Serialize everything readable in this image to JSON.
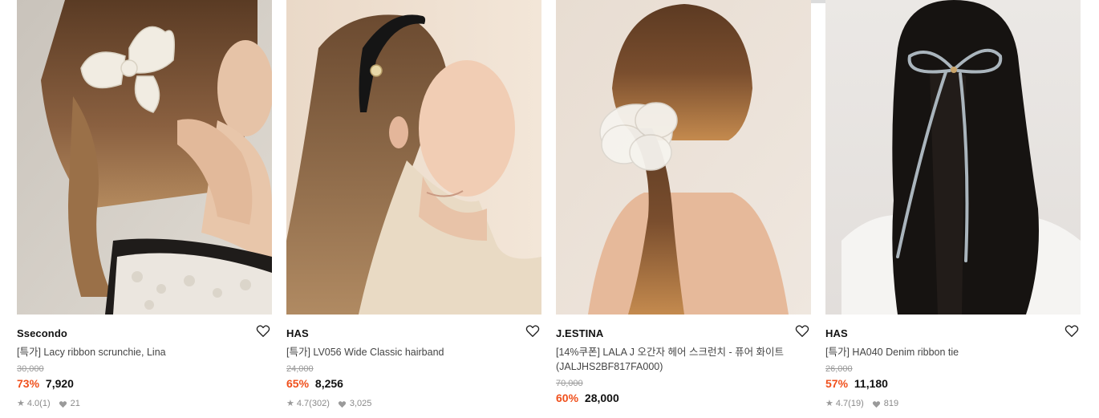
{
  "products": [
    {
      "brand": "Ssecondo",
      "name": "[특가] Lacy ribbon scrunchie, Lina",
      "original_price": "30,000",
      "discount": "73%",
      "price": "7,920",
      "rating": "4.0",
      "reviews": "(1)",
      "likes": "21",
      "image": "woman-with-lace-bow-scrunchie"
    },
    {
      "brand": "HAS",
      "name": "[특가] LV056 Wide Classic hairband",
      "original_price": "24,000",
      "discount": "65%",
      "price": "8,256",
      "rating": "4.7",
      "reviews": "(302)",
      "likes": "3,025",
      "image": "woman-with-black-hairband"
    },
    {
      "brand": "J.ESTINA",
      "name": "[14%쿠폰] LALA J 오간자 헤어 스크런치 - 퓨어 화이트 (JALJHS2BF817FA000)",
      "original_price": "70,000",
      "discount": "60%",
      "price": "28,000",
      "image": "woman-with-white-organza-scrunchie"
    },
    {
      "brand": "HAS",
      "name": "[특가] HA040 Denim ribbon tie",
      "original_price": "26,000",
      "discount": "57%",
      "price": "11,180",
      "rating": "4.7",
      "reviews": "(19)",
      "likes": "819",
      "image": "woman-with-ribbon-tie"
    }
  ],
  "colors": {
    "discount": "#f0501c",
    "brand_text": "#111111",
    "meta_text": "#8a8a8a"
  },
  "icons": {
    "wishlist": "heart-outline-icon",
    "rating": "star-icon",
    "likes": "heart-filled-icon"
  }
}
